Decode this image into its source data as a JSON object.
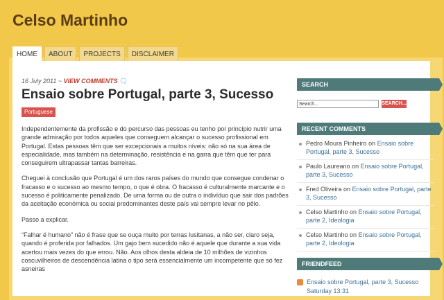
{
  "site": {
    "title": "Celso Martinho"
  },
  "nav": {
    "tabs": [
      "HOME",
      "ABOUT",
      "PROJECTS",
      "DISCLAIMER"
    ]
  },
  "post": {
    "date": "16 July 2011 ~",
    "view_comments": "VIEW COMMENTS",
    "title": "Ensaio sobre Portugal, parte 3, Sucesso",
    "tag": "Portuguese",
    "paragraphs": [
      "Independentemente da profissão e do percurso das pessoas eu tenho por princípio nutrir uma grande admiração por todos aqueles que conseguem alcançar o sucesso profissional em Portugal. Estas pessoas têm que ser excepcionais a muitos níveis: não só na sua área de especialidade, mas também na determinação, resistência e na garra que têm que ter para conseguirem ultrapassar tantas barreiras.",
      "Cheguei à conclusão que Portugal é um dos raros países do mundo que consegue condenar o fracasso e o sucesso ao mesmo tempo, o que é obra. O fracasso é culturalmente marcante e o sucesso é politicamente penalizado. De uma forma ou de outra o indivíduo que sair dos padrões da aceitação económica ou social predominantes deste país vai sempre levar no pêlo.",
      "Passo a explicar.",
      "“Falhar é humano” não é frase que se ouça muito por terras lusitanas, a não ser, claro seja, quando é proferida por falhados. Um gajo bem sucedido não é aquele que durante a sua vida acertou mais vezes do que errou. Não. Aos olhos desta aldeia de 10 milhões de vizinhos coscuvilheiros de descendência latina o tipo será essencialmente um incompetente que só fez asneiras"
    ]
  },
  "sidebar": {
    "search": {
      "heading": "SEARCH",
      "value": "Search...",
      "button": "SEARCH..."
    },
    "recent": {
      "heading": "RECENT COMMENTS",
      "items": [
        {
          "author": "Pedro Moura Pinheiro",
          "on": " on ",
          "post": "Ensaio sobre Portugal, parte 3, Sucesso"
        },
        {
          "author": "Paulo Laureano",
          "on": " on ",
          "post": "Ensaio sobre Portugal, parte 3, Sucesso"
        },
        {
          "author": "Fred Oliveira",
          "on": " on ",
          "post": "Ensaio sobre Portugal, parte 3, Sucesso"
        },
        {
          "author": "Celso Martinho",
          "on": " on ",
          "post": "Ensaio sobre Portugal, parte 2, Ideologia"
        },
        {
          "author": "Celso Martinho",
          "on": " on ",
          "post": "Ensaio sobre Portugal, parte 2, Ideologia"
        }
      ]
    },
    "friendfeed": {
      "heading": "FRIENDFEED",
      "items": [
        {
          "text": "Ensaio sobre Portugal, parte 3, Sucesso",
          "time": "Saturday 13:31"
        }
      ]
    }
  }
}
